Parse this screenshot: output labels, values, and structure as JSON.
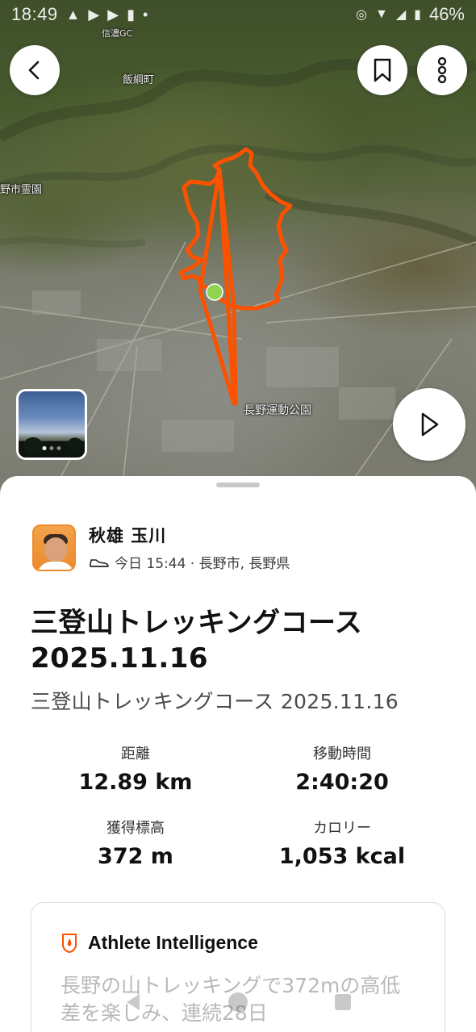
{
  "status_bar": {
    "time": "18:49",
    "battery": "46%"
  },
  "map": {
    "labels": {
      "golf": "信濃GC",
      "town": "飯綱町",
      "cemetery": "野市霊園",
      "park": "長野運動公園"
    },
    "route_color": "#fc5200",
    "marker_color": "#8fd34f"
  },
  "buttons": {
    "back": "back",
    "bookmark": "bookmark",
    "more": "more",
    "play": "play"
  },
  "athlete": {
    "name": "秋雄 玉川",
    "meta": "今日 15:44 · 長野市, 長野県"
  },
  "activity": {
    "title": "三登山トレッキングコース 2025.11.16",
    "description": "三登山トレッキングコース 2025.11.16"
  },
  "stats": [
    {
      "label": "距離",
      "value": "12.89 km"
    },
    {
      "label": "移動時間",
      "value": "2:40:20"
    },
    {
      "label": "獲得標高",
      "value": "372 m"
    },
    {
      "label": "カロリー",
      "value": "1,053 kcal"
    }
  ],
  "athlete_intelligence": {
    "title": "Athlete Intelligence",
    "text": "長野の山トレッキングで372mの高低差を楽しみ、連続28日"
  },
  "colors": {
    "accent": "#fc5200",
    "text": "#111111"
  }
}
